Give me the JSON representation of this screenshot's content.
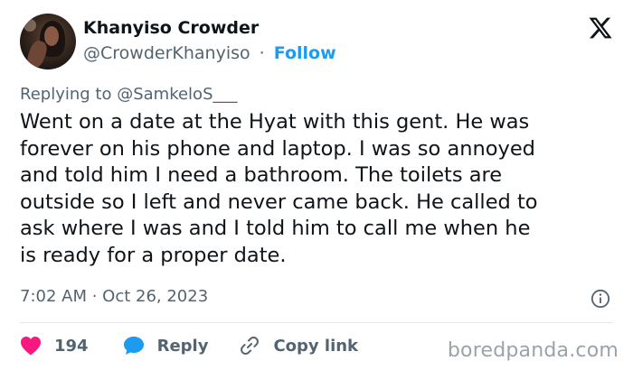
{
  "author": {
    "display_name": "Khanyiso Crowder",
    "handle": "@CrowderKhanyiso",
    "separator": "·",
    "follow_label": "Follow"
  },
  "reply_context": {
    "prefix": "Replying to ",
    "mention": "@SamkeloS___"
  },
  "tweet": {
    "text": "Went on a date at the Hyat with this gent. He was\nforever on his phone and laptop. I was so annoyed\nand told him I need a bathroom. The toilets are\noutside so I left and never came back. He called to\nask where I was and I told him to call me when he\nis ready for a proper date.",
    "timestamp": "7:02 AM · Oct 26, 2023"
  },
  "actions": {
    "like_count": "194",
    "reply_label": "Reply",
    "copy_link_label": "Copy link"
  },
  "watermark": "boredpanda.com",
  "icons": {
    "logo": "x-logo-icon",
    "info": "info-icon",
    "like": "heart-icon",
    "reply": "speech-bubble-icon",
    "copy": "link-icon"
  },
  "colors": {
    "text": "#0f1419",
    "secondary": "#536471",
    "accent": "#1d9bf0",
    "like": "#f91880"
  }
}
